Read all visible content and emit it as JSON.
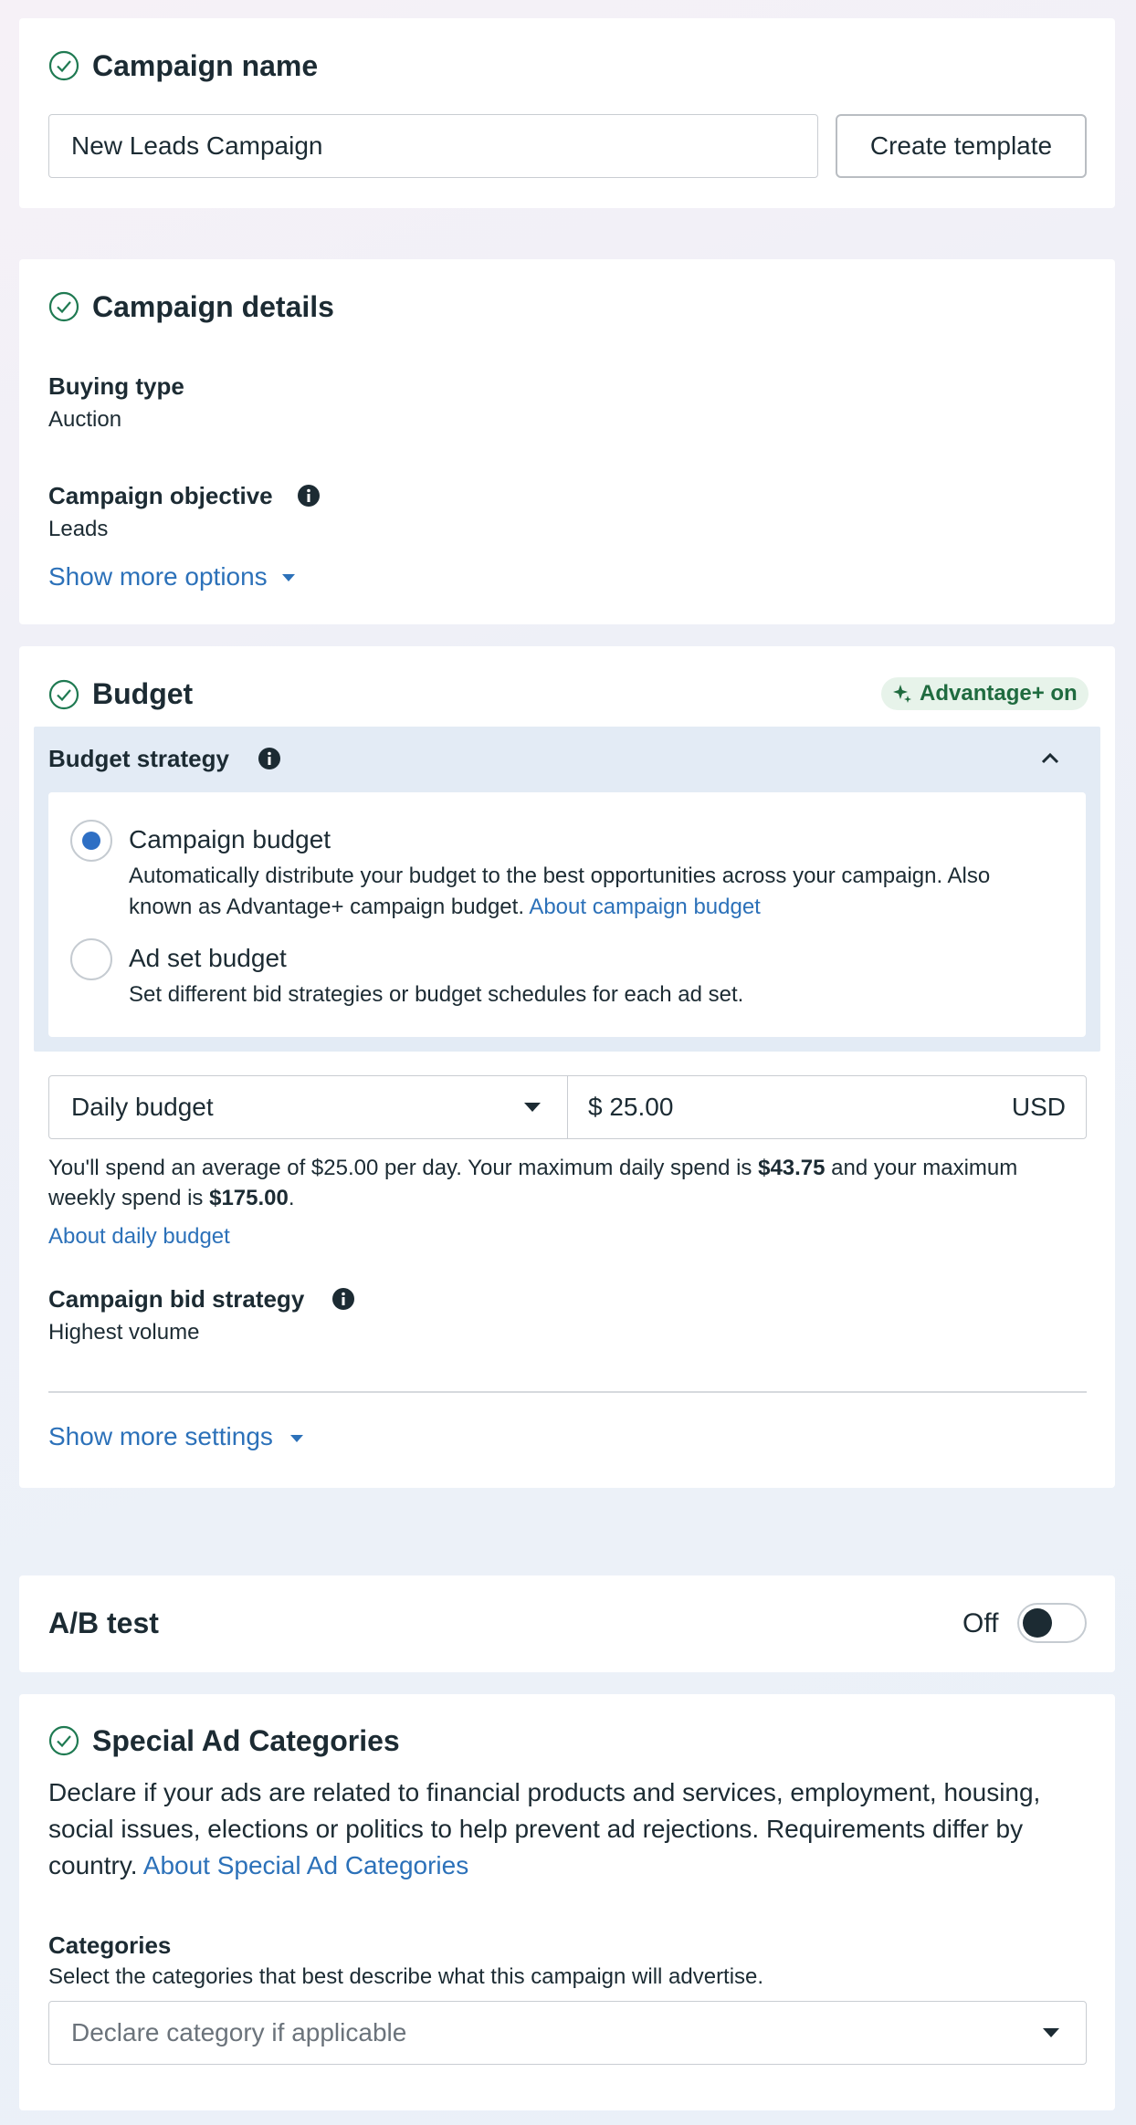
{
  "campaign_name": {
    "title": "Campaign name",
    "input_value": "New Leads Campaign",
    "create_template_label": "Create template"
  },
  "campaign_details": {
    "title": "Campaign details",
    "buying_type_label": "Buying type",
    "buying_type_value": "Auction",
    "objective_label": "Campaign objective",
    "objective_value": "Leads",
    "show_more_options": "Show more options"
  },
  "budget": {
    "title": "Budget",
    "advantage_badge": "Advantage+ on",
    "strategy_label": "Budget strategy",
    "options": [
      {
        "title": "Campaign budget",
        "desc_line1": "Automatically distribute your budget to the best opportunities across your campaign. Also",
        "desc_line2": "known as Advantage+ campaign budget.",
        "link": "About campaign budget",
        "selected": true
      },
      {
        "title": "Ad set budget",
        "desc_line1": "Set different bid strategies or budget schedules for each ad set.",
        "selected": false
      }
    ],
    "budget_type": "Daily budget",
    "currency_symbol": "$",
    "amount": "25.00",
    "currency": "USD",
    "spend_text_1": "You'll spend an average of $25.00 per day. Your maximum daily spend is",
    "max_daily": "$43.75",
    "spend_text_2": "and your maximum",
    "spend_text_3": "weekly spend is",
    "max_weekly": "$175.00",
    "spend_period": ".",
    "about_daily_budget": "About daily budget",
    "bid_strategy_label": "Campaign bid strategy",
    "bid_strategy_value": "Highest volume",
    "show_more_settings": "Show more settings"
  },
  "ab_test": {
    "title": "A/B test",
    "toggle_label": "Off",
    "enabled": false
  },
  "special_ad_categories": {
    "title": "Special Ad Categories",
    "desc_line1": "Declare if your ads are related to financial products and services, employment, housing,",
    "desc_line2": "social issues, elections or politics to help prevent ad rejections. Requirements differ by",
    "desc_line3": "country.",
    "link": "About Special Ad Categories",
    "categories_label": "Categories",
    "categories_help": "Select the categories that best describe what this campaign will advertise.",
    "select_placeholder": "Declare category if applicable"
  },
  "colors": {
    "link": "#2c71b9",
    "radio_selected": "#2e6fc4",
    "check_icon": "#1f7a52",
    "advantage_badge_bg": "#e7f3ea",
    "advantage_badge_text": "#1f6b3f",
    "strategy_panel_bg": "#e3ebf5"
  }
}
